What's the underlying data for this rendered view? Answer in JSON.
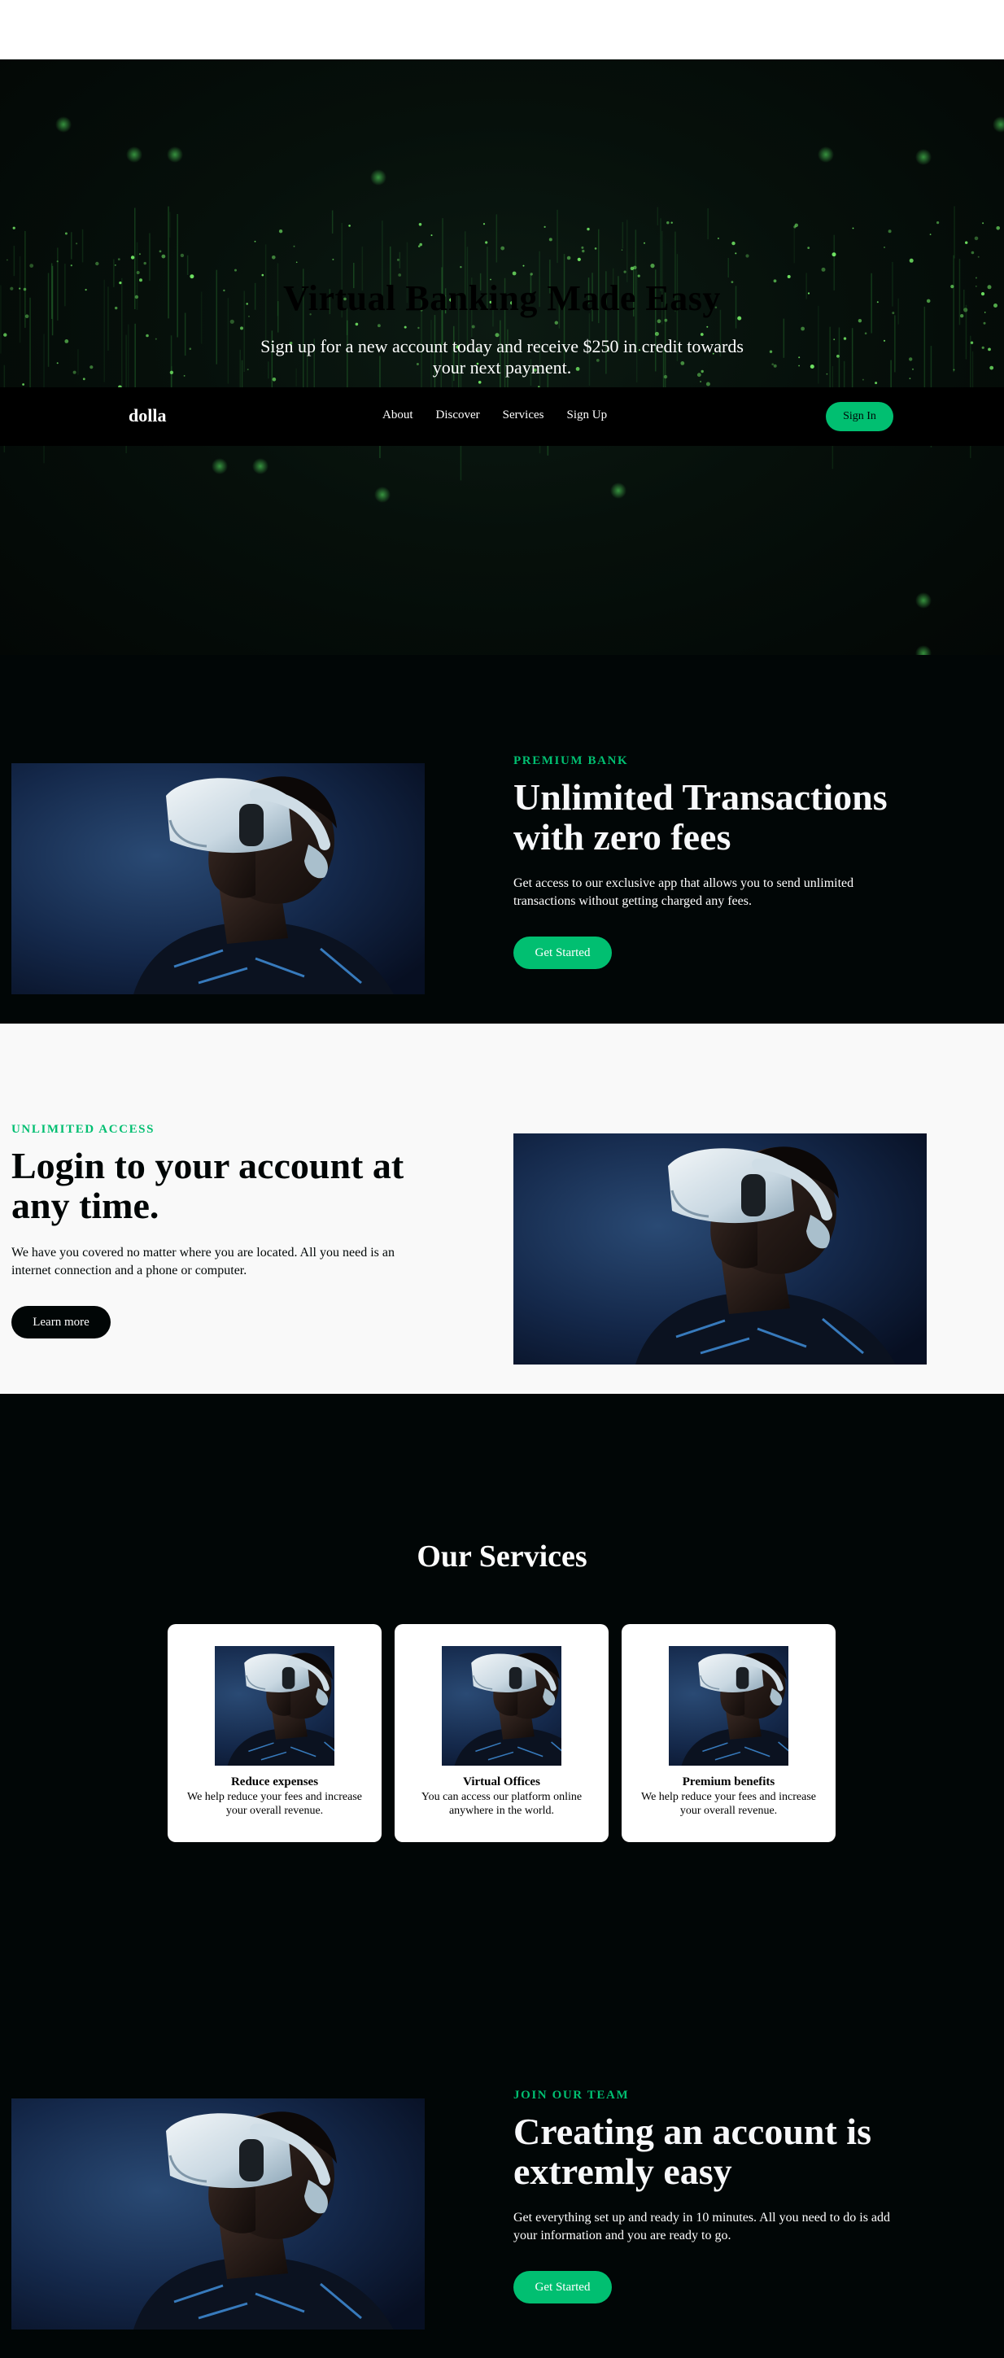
{
  "hero": {
    "title": "Virtual Banking Made Easy",
    "subtitle": "Sign up for a new account today and receive $250 in credit towards your next payment."
  },
  "nav": {
    "logo": "dolla",
    "links": [
      "About",
      "Discover",
      "Services",
      "Sign Up"
    ],
    "signin": "Sign In"
  },
  "sections": [
    {
      "eyebrow": "Premium Bank",
      "headline": "Unlimited Transactions with zero fees",
      "text": "Get access to our exclusive app that allows you to send unlimited transactions without getting charged any fees.",
      "button": "Get Started"
    },
    {
      "eyebrow": "Unlimited Access",
      "headline": "Login to your account at any time.",
      "text": "We have you covered no matter where you are located. All you need is an internet connection and a phone or computer.",
      "button": "Learn more"
    },
    {
      "eyebrow": "Join our Team",
      "headline": "Creating an account is extremly easy",
      "text": "Get everything set up and ready in 10 minutes. All you need to do is add your information and you are ready to go.",
      "button": "Get Started"
    }
  ],
  "services": {
    "title": "Our Services",
    "cards": [
      {
        "title": "Reduce expenses",
        "text": "We help reduce your fees and increase your overall revenue."
      },
      {
        "title": "Virtual Offices",
        "text": "You can access our platform online anywhere in the world."
      },
      {
        "title": "Premium benefits",
        "text": "We help reduce your fees and increase your overall revenue."
      }
    ]
  },
  "colors": {
    "accent": "#01bf71",
    "dark_bg": "#010606",
    "light_bg": "#f9f9f9",
    "nav_bg": "#000000"
  },
  "images": {
    "vr_photo": "person-wearing-vr-headset"
  }
}
